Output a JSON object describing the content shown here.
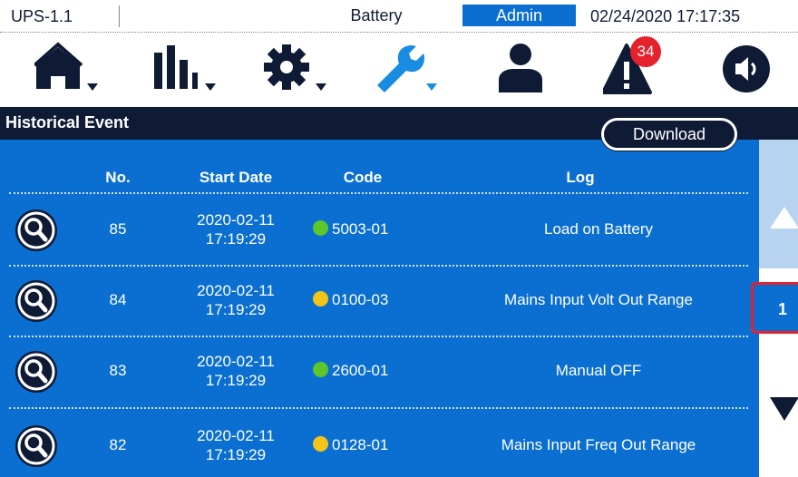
{
  "status_bar": {
    "device": "UPS-1.1",
    "status": "Battery",
    "user": "Admin",
    "datetime": "02/24/2020  17:17:35"
  },
  "nav": {
    "alarm_count": "34",
    "icons": [
      "home-icon",
      "bar-chart-icon",
      "gear-icon",
      "wrench-icon",
      "user-icon",
      "alarm-icon",
      "sound-icon"
    ],
    "active_color": "#1a8ce0",
    "default_color": "#0f1b35"
  },
  "page": {
    "title": "Historical Event",
    "download_label": "Download"
  },
  "table": {
    "headers": {
      "no": "No.",
      "start_date": "Start Date",
      "code": "Code",
      "log": "Log"
    },
    "rows": [
      {
        "no": "85",
        "date": "2020-02-11",
        "time": "17:19:29",
        "code": "5003-01",
        "status_color": "#5cc62b",
        "log": "Load on Battery"
      },
      {
        "no": "84",
        "date": "2020-02-11",
        "time": "17:19:29",
        "code": "0100-03",
        "status_color": "#f4c417",
        "log": "Mains Input Volt Out Range"
      },
      {
        "no": "83",
        "date": "2020-02-11",
        "time": "17:19:29",
        "code": "2600-01",
        "status_color": "#5cc62b",
        "log": "Manual OFF"
      },
      {
        "no": "82",
        "date": "2020-02-11",
        "time": "17:19:29",
        "code": "0128-01",
        "status_color": "#f4c417",
        "log": "Mains Input Freq Out Range"
      }
    ]
  },
  "pager": {
    "current_page": "1"
  },
  "colors": {
    "navy": "#0f1b35",
    "blue": "#0a6fd1",
    "alert_red": "#e5212e"
  }
}
